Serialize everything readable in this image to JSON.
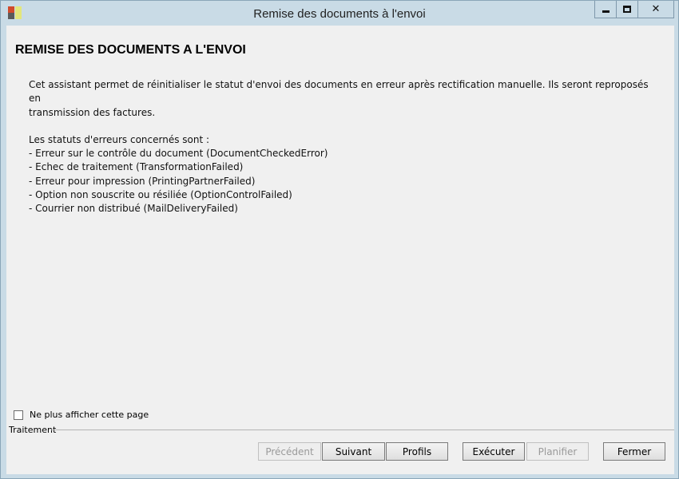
{
  "window": {
    "title": "Remise des documents à l'envoi"
  },
  "content": {
    "heading": "REMISE DES DOCUMENTS A L'ENVOI",
    "intro_line1": "Cet assistant permet de réinitialiser le statut d'envoi des documents en erreur après rectification manuelle. Ils seront reproposés en",
    "intro_line2": "transmission des factures.",
    "statuses_title": "Les statuts d'erreurs concernés sont :",
    "statuses": [
      "- Erreur sur le contrôle du document (DocumentCheckedError)",
      "- Echec de traitement (TransformationFailed)",
      "- Erreur pour impression (PrintingPartnerFailed)",
      "- Option non souscrite ou résiliée (OptionControlFailed)",
      "- Courrier non distribué (MailDeliveryFailed)"
    ]
  },
  "options": {
    "dont_show_label": "Ne plus afficher cette page",
    "dont_show_checked": false
  },
  "group": {
    "label": "Traitement"
  },
  "buttons": {
    "previous": "Précédent",
    "next": "Suivant",
    "profiles": "Profils",
    "execute": "Exécuter",
    "schedule": "Planifier",
    "close": "Fermer"
  }
}
